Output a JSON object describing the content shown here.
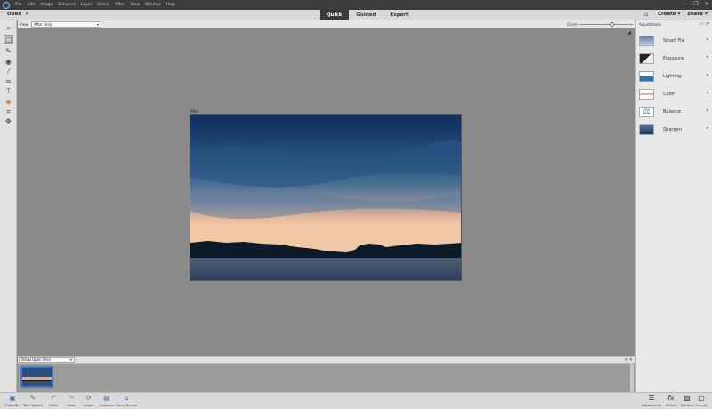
{
  "menubar": {
    "items": [
      "File",
      "Edit",
      "Image",
      "Enhance",
      "Layer",
      "Select",
      "Filter",
      "View",
      "Window",
      "Help"
    ]
  },
  "modebar": {
    "open_label": "Open",
    "tabs": [
      {
        "label": "Quick",
        "active": true
      },
      {
        "label": "Guided",
        "active": false
      },
      {
        "label": "Expert",
        "active": false
      }
    ],
    "create_label": "Create",
    "share_label": "Share"
  },
  "options": {
    "view_label": "View:",
    "view_value": "After Only",
    "zoom_label": "Zoom:",
    "zoom_value": "100%",
    "zoom_level": 0.6
  },
  "canvas": {
    "after_label": "After"
  },
  "adjustments": {
    "title": "Adjustments",
    "items": [
      {
        "label": "Smart Fix",
        "icon": "smart-fix-icon"
      },
      {
        "label": "Exposure",
        "icon": "exposure-icon"
      },
      {
        "label": "Lighting",
        "icon": "lighting-icon"
      },
      {
        "label": "Color",
        "icon": "color-icon"
      },
      {
        "label": "Balance",
        "icon": "balance-icon"
      },
      {
        "label": "Sharpen",
        "icon": "sharpen-icon"
      }
    ]
  },
  "bin": {
    "select_value": "Show Open Files"
  },
  "bottombar": {
    "left": [
      {
        "label": "Photo Bin",
        "icon": "photo-bin-icon"
      },
      {
        "label": "Tool Options",
        "icon": "tool-options-icon"
      },
      {
        "label": "Undo",
        "icon": "undo-icon"
      },
      {
        "label": "Redo",
        "icon": "redo-icon"
      },
      {
        "label": "Rotate",
        "icon": "rotate-icon"
      },
      {
        "label": "Organizer",
        "icon": "organizer-icon"
      },
      {
        "label": "Home Screen",
        "icon": "home-screen-icon"
      }
    ],
    "right": [
      {
        "label": "Adjustments",
        "icon": "adjustments-icon"
      },
      {
        "label": "Effects",
        "icon": "effects-icon"
      },
      {
        "label": "Textures",
        "icon": "textures-icon"
      },
      {
        "label": "Frames",
        "icon": "frames-icon"
      }
    ]
  },
  "colors": {
    "accent": "#3b7bd6",
    "active_tab_bg": "#3a3a3a"
  }
}
